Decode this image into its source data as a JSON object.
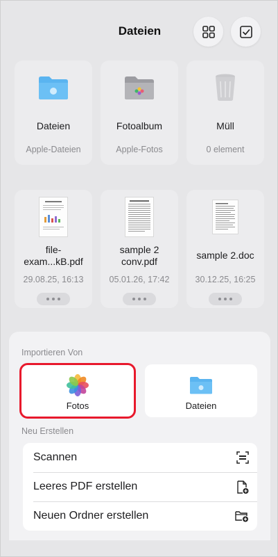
{
  "header": {
    "title": "Dateien"
  },
  "cards": [
    {
      "name": "Dateien",
      "sub": "Apple-Dateien",
      "icon": "folder-icon"
    },
    {
      "name": "Fotoalbum",
      "sub": "Apple-Fotos",
      "icon": "photo-album-folder-icon"
    },
    {
      "name": "Müll",
      "sub": "0 element",
      "icon": "trash-icon"
    },
    {
      "name": "file-\nexam...kB.pdf",
      "sub": "29.08.25, 16:13",
      "icon": "pdf-thumbnail"
    },
    {
      "name": "sample 2\nconv.pdf",
      "sub": "05.01.26, 17:42",
      "icon": "pdf-thumbnail"
    },
    {
      "name": "sample 2.doc",
      "sub": "30.12.25, 16:25",
      "icon": "doc-thumbnail"
    }
  ],
  "sheet": {
    "import_label": "Importieren Von",
    "import_options": [
      {
        "label": "Fotos",
        "icon": "photos-icon"
      },
      {
        "label": "Dateien",
        "icon": "folder-icon"
      }
    ],
    "create_label": "Neu Erstellen",
    "create_items": [
      {
        "label": "Scannen",
        "icon": "scan-icon"
      },
      {
        "label": "Leeres PDF erstellen",
        "icon": "new-document-icon"
      },
      {
        "label": "Neuen Ordner erstellen",
        "icon": "new-folder-icon"
      }
    ]
  },
  "colors": {
    "accent_folder": "#5ab4f0",
    "highlight": "#e8192c",
    "background": "#e6e6e8"
  }
}
